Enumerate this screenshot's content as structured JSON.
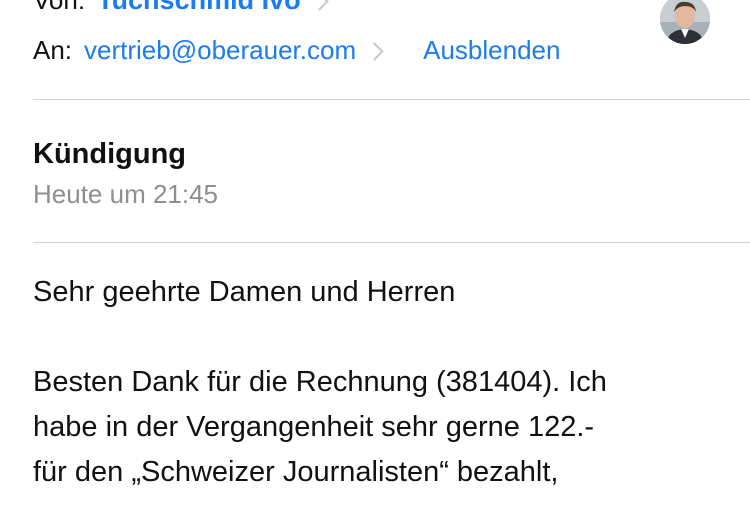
{
  "header": {
    "from_label": "Von:",
    "from_name": "Tuchschmid Ivo",
    "to_label": "An:",
    "to_address": "vertrieb@oberauer.com",
    "hide_label": "Ausblenden"
  },
  "message": {
    "subject": "Kündigung",
    "date": "Heute um 21:45",
    "body_lines": [
      "Sehr geehrte Damen und Herren",
      "Besten Dank für die Rechnung (381404). Ich",
      "habe in der Vergangenheit sehr gerne 122.-",
      "für den „Schweizer Journalisten“ bezahlt,"
    ]
  },
  "colors": {
    "link": "#1a7cf2",
    "secondary_text": "#8e8e93",
    "divider": "#d1d1d6"
  }
}
